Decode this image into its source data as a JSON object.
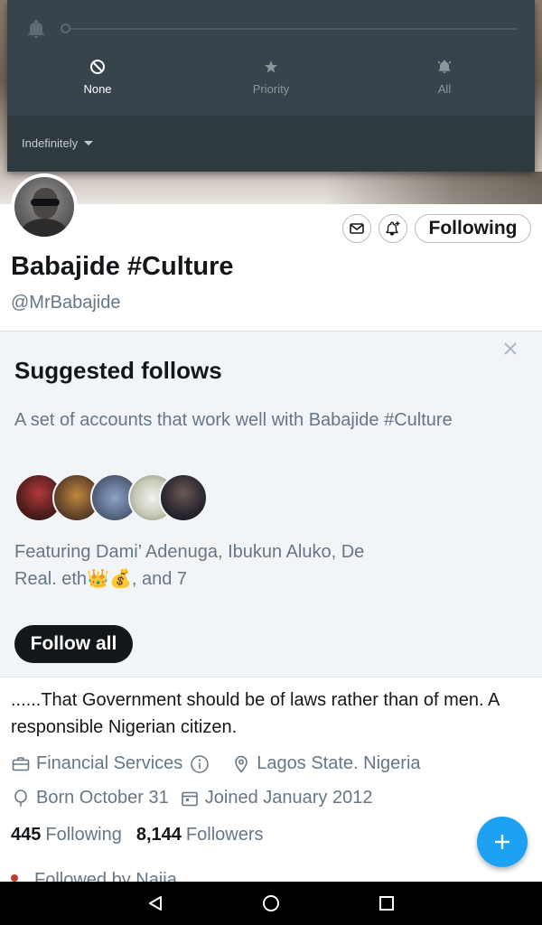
{
  "notification_panel": {
    "modes": [
      {
        "label": "None",
        "icon": "block-icon",
        "active": true
      },
      {
        "label": "Priority",
        "icon": "star-icon",
        "active": false
      },
      {
        "label": "All",
        "icon": "bell-ringing-icon",
        "active": false
      }
    ],
    "duration": "Indefinitely"
  },
  "profile": {
    "display_name": "Babajide #Culture",
    "handle": "@MrBabajide",
    "following_button": "Following",
    "bio": "......That Government should be of laws rather than of men. A responsible Nigerian citizen.",
    "category": "Financial Services",
    "location": "Lagos State. Nigeria",
    "born": "Born October 31",
    "joined": "Joined January 2012",
    "following_count": "445",
    "following_label": "Following",
    "followers_count": "8,144",
    "followers_label": "Followers",
    "followed_by": "Followed by Naija"
  },
  "suggested": {
    "title": "Suggested follows",
    "description": "A set of accounts that work well with Babajide #Culture",
    "featuring": "Featuring Dami’ Adenuga, Ibukun Aluko, De Real. eth👑💰, and 7",
    "follow_all": "Follow all"
  },
  "colors": {
    "accent": "#1da1f2",
    "text_primary": "#14171a",
    "text_secondary": "#657786"
  }
}
